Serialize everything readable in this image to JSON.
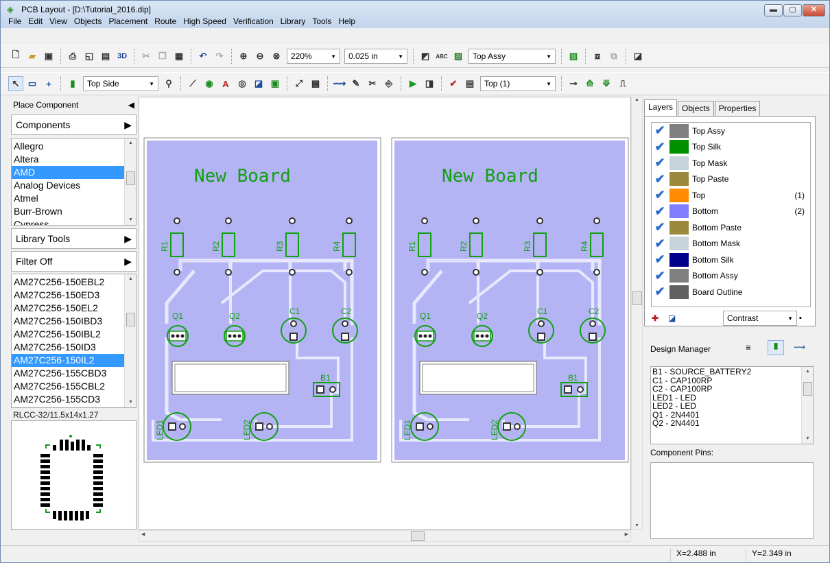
{
  "window": {
    "title": "PCB Layout - [D:\\Tutorial_2016.dip]"
  },
  "menu": [
    "File",
    "Edit",
    "View",
    "Objects",
    "Placement",
    "Route",
    "High Speed",
    "Verification",
    "Library",
    "Tools",
    "Help"
  ],
  "toolbar1": {
    "zoom": "220%",
    "grid": "0.025 in",
    "assy_layer": "Top Assy",
    "button_3d": "3D",
    "abc_label": "ABC"
  },
  "toolbar2": {
    "side": "Top Side",
    "active_layer": "Top (1)"
  },
  "left_panel": {
    "header": "Place Component",
    "components_btn": "Components",
    "libraries": [
      "Allegro",
      "Altera",
      "AMD",
      "Analog Devices",
      "Atmel",
      "Burr-Brown",
      "Cypress"
    ],
    "selected_library": "AMD",
    "library_tools_btn": "Library Tools",
    "filter_btn": "Filter Off",
    "parts": [
      "AM27C256-150EBL2",
      "AM27C256-150ED3",
      "AM27C256-150EL2",
      "AM27C256-150IBD3",
      "AM27C256-150IBL2",
      "AM27C256-150ID3",
      "AM27C256-150IL2",
      "AM27C256-155CBD3",
      "AM27C256-155CBL2",
      "AM27C256-155CD3"
    ],
    "selected_part": "AM27C256-150IL2",
    "package": "RLCC-32/11.5x14x1.27"
  },
  "boards": {
    "title": "New Board",
    "resistors": [
      "R1",
      "R2",
      "R3",
      "R4"
    ],
    "transistors": [
      "Q1",
      "Q2"
    ],
    "caps": [
      "C1",
      "C2"
    ],
    "battery": "B1",
    "leds": [
      "LED1",
      "LED2"
    ]
  },
  "right_panel": {
    "tabs": [
      "Layers",
      "Objects",
      "Properties"
    ],
    "active_tab": "Layers",
    "layers": [
      {
        "name": "Top Assy",
        "color": "#808080",
        "num": ""
      },
      {
        "name": "Top Silk",
        "color": "#009000",
        "num": ""
      },
      {
        "name": "Top Mask",
        "color": "#c8d4dc",
        "num": ""
      },
      {
        "name": "Top Paste",
        "color": "#9c8a3c",
        "num": ""
      },
      {
        "name": "Top",
        "color": "#ff8c00",
        "num": "(1)"
      },
      {
        "name": "Bottom",
        "color": "#8080ff",
        "num": "(2)"
      },
      {
        "name": "Bottom Paste",
        "color": "#9c8a3c",
        "num": ""
      },
      {
        "name": "Bottom Mask",
        "color": "#c8d4dc",
        "num": ""
      },
      {
        "name": "Bottom Silk",
        "color": "#00008c",
        "num": ""
      },
      {
        "name": "Bottom Assy",
        "color": "#808080",
        "num": ""
      },
      {
        "name": "Board Outline",
        "color": "#606060",
        "num": ""
      }
    ],
    "contrast": "Contrast",
    "design_manager": "Design Manager",
    "dm_items": [
      "B1 - SOURCE_BATTERY2",
      "C1 - CAP100RP",
      "C2 - CAP100RP",
      "LED1 - LED",
      "LED2 - LED",
      "Q1 - 2N4401",
      "Q2 - 2N4401"
    ],
    "component_pins": "Component Pins:"
  },
  "status": {
    "x": "X=2.488 in",
    "y": "Y=2.349 in"
  }
}
